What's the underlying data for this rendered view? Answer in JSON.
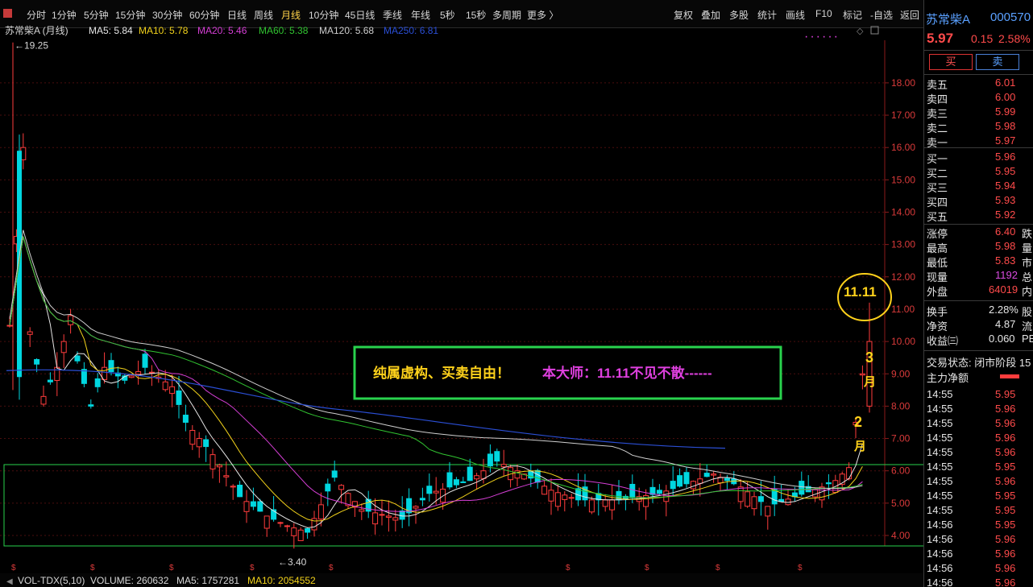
{
  "toolbar": {
    "tabs": [
      "分时",
      "1分钟",
      "5分钟",
      "15分钟",
      "30分钟",
      "60分钟",
      "日线",
      "周线",
      "月线",
      "10分钟",
      "45日线",
      "季线",
      "年线",
      "5秒",
      "15秒",
      "多周期",
      "更多 〉"
    ],
    "active_tab": "月线",
    "right_buttons": [
      "复权",
      "叠加",
      "多股",
      "统计",
      "画线",
      "F10",
      "标记",
      "-自选",
      "返回"
    ]
  },
  "chart_header": {
    "title": "苏常柴A (月线)",
    "ma": [
      {
        "label": "MA5: 5.84",
        "color": "#e6e6e6"
      },
      {
        "label": "MA10: 5.78",
        "color": "#f2d21b"
      },
      {
        "label": "MA20: 5.46",
        "color": "#d63fd6"
      },
      {
        "label": "MA60: 5.38",
        "color": "#31c431"
      },
      {
        "label": "MA120: 5.68",
        "color": "#cfcfcf"
      },
      {
        "label": "MA250: 6.81",
        "color": "#2b4fd6"
      }
    ]
  },
  "chart_data": {
    "type": "candlestick",
    "y_ticks": [
      "18.00",
      "17.00",
      "16.00",
      "15.00",
      "14.00",
      "13.00",
      "12.00",
      "11.00",
      "10.00",
      "9.00",
      "8.00",
      "7.00",
      "6.00",
      "5.00",
      "4.00"
    ],
    "high_label": "19.25",
    "low_label": "3.40",
    "annotation_box_text_yellow": "纯属虚构、买卖自由！",
    "annotation_box_text_magenta": "本大师：11.11不见不散------",
    "circle_label": "11.11",
    "month3": [
      "3",
      "月"
    ],
    "month2": [
      "2",
      "月"
    ],
    "series": {
      "up_color": "#ff3c3c",
      "down_color": "#00d7e0"
    }
  },
  "volume_header": {
    "label": "VOL-TDX(5,10)",
    "volume": "VOLUME: 260632",
    "ma5": "MA5: 1757281",
    "ma10": "MA10: 2054552"
  },
  "quote": {
    "name": "苏常柴A",
    "code": "000570",
    "price": "5.97",
    "change": "0.15",
    "pct": "2.58%",
    "buy_label": "买",
    "sell_label": "卖",
    "asks": [
      {
        "label": "卖五",
        "price": "6.01"
      },
      {
        "label": "卖四",
        "price": "6.00"
      },
      {
        "label": "卖三",
        "price": "5.99"
      },
      {
        "label": "卖二",
        "price": "5.98"
      },
      {
        "label": "卖一",
        "price": "5.97"
      }
    ],
    "bids": [
      {
        "label": "买一",
        "price": "5.96"
      },
      {
        "label": "买二",
        "price": "5.95"
      },
      {
        "label": "买三",
        "price": "5.94"
      },
      {
        "label": "买四",
        "price": "5.93"
      },
      {
        "label": "买五",
        "price": "5.92"
      }
    ],
    "stats": [
      {
        "label": "涨停",
        "value": "6.40",
        "extra": "跌",
        "color": "red"
      },
      {
        "label": "最高",
        "value": "5.98",
        "extra": "量",
        "color": "red"
      },
      {
        "label": "最低",
        "value": "5.83",
        "extra": "市",
        "color": "red"
      },
      {
        "label": "现量",
        "value": "1192",
        "extra": "总",
        "color": "mag"
      },
      {
        "label": "外盘",
        "value": "64019",
        "extra": "内",
        "color": "red"
      },
      {
        "label": "换手",
        "value": "2.28%",
        "extra": "股",
        "color": "wht"
      },
      {
        "label": "净资",
        "value": "4.87",
        "extra": "流",
        "color": "wht"
      },
      {
        "label": "收益㈢",
        "value": "0.060",
        "extra": "PE",
        "color": "wht"
      }
    ],
    "trade_status": "交易状态: 闭市阶段 15",
    "net_label": "主力净额",
    "ticks": [
      {
        "time": "14:55",
        "price": "5.95"
      },
      {
        "time": "14:55",
        "price": "5.96"
      },
      {
        "time": "14:55",
        "price": "5.96"
      },
      {
        "time": "14:55",
        "price": "5.96"
      },
      {
        "time": "14:55",
        "price": "5.96"
      },
      {
        "time": "14:55",
        "price": "5.95"
      },
      {
        "time": "14:55",
        "price": "5.96"
      },
      {
        "time": "14:55",
        "price": "5.95"
      },
      {
        "time": "14:55",
        "price": "5.95"
      },
      {
        "time": "14:56",
        "price": "5.95"
      },
      {
        "time": "14:56",
        "price": "5.96"
      },
      {
        "time": "14:56",
        "price": "5.96"
      },
      {
        "time": "14:56",
        "price": "5.96"
      },
      {
        "time": "14:56",
        "price": "5.96"
      }
    ]
  }
}
